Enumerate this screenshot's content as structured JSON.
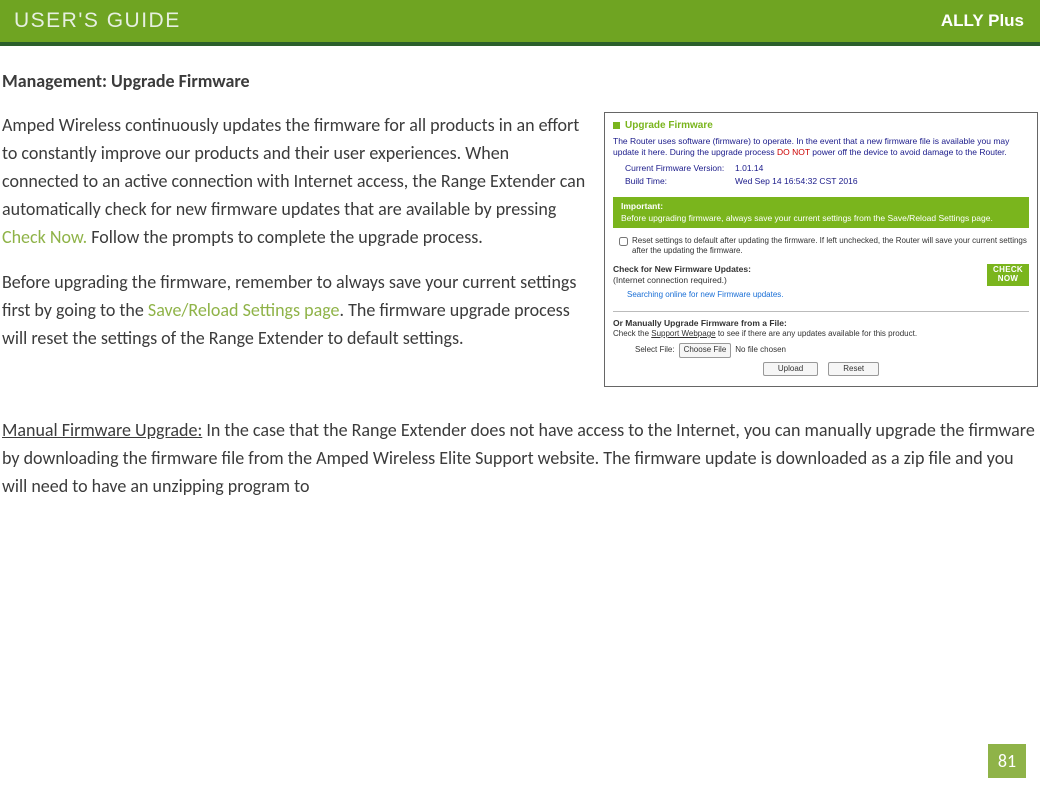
{
  "header": {
    "left": "USER'S GUIDE",
    "right": "ALLY Plus"
  },
  "title": "Management: Upgrade Firmware",
  "para1_a": "Amped Wireless continuously updates the firmware for all products in an effort to constantly improve our products and their user experiences. When connected to an active connection with Internet access, the Range Extender can automatically check for new firmware updates that are available by pressing ",
  "para1_link": "Check Now.",
  "para1_b": " Follow the prompts to complete the upgrade process.",
  "para2_a": "Before upgrading the firmware, remember to always save your current settings first by going to the ",
  "para2_link": "Save/Reload Settings page",
  "para2_b": ". The firmware upgrade process will reset the settings of the Range Extender to default settings.",
  "manual_label": "Manual Firmware Upgrade:",
  "manual_text": " In the case that the Range Extender does not have access to the Internet, you can manually upgrade the firmware by downloading the firmware file from the Amped Wireless Elite Support website. The firmware update is downloaded as a zip file and you will need to have an unzipping program to",
  "page_num": "81",
  "screenshot": {
    "title": "Upgrade Firmware",
    "desc_a": "The Router uses software (firmware) to operate. In the event that a new firmware file is available you may update it here. During the upgrade process ",
    "desc_red": "DO NOT",
    "desc_b": " power off the device to avoid damage to the Router.",
    "ver_label": "Current Firmware Version:",
    "ver_value": "1.01.14",
    "build_label": "Build Time:",
    "build_value": "Wed Sep 14 16:54:32 CST 2016",
    "important_t": "Important:",
    "important_b": "Before upgrading firmware, always save your current settings from the Save/Reload Settings page.",
    "reset_text": "Reset settings to default after updating the firmware. If left unchecked, the Router will save your current settings after the updating the firmware.",
    "checknew_t": "Check for New Firmware Updates:",
    "checknew_s": "(Internet connection required.)",
    "check_btn_1": "CHECK",
    "check_btn_2": "NOW",
    "searching": "Searching online for new Firmware updates.",
    "manual_t": "Or Manually Upgrade Firmware from a File:",
    "manual_d_a": "Check the ",
    "manual_d_link": "Support Webpage",
    "manual_d_b": " to see if there are any updates available for this product.",
    "select_file": "Select File:",
    "choose_file": "Choose File",
    "no_file": "No file chosen",
    "upload": "Upload",
    "reset": "Reset"
  }
}
